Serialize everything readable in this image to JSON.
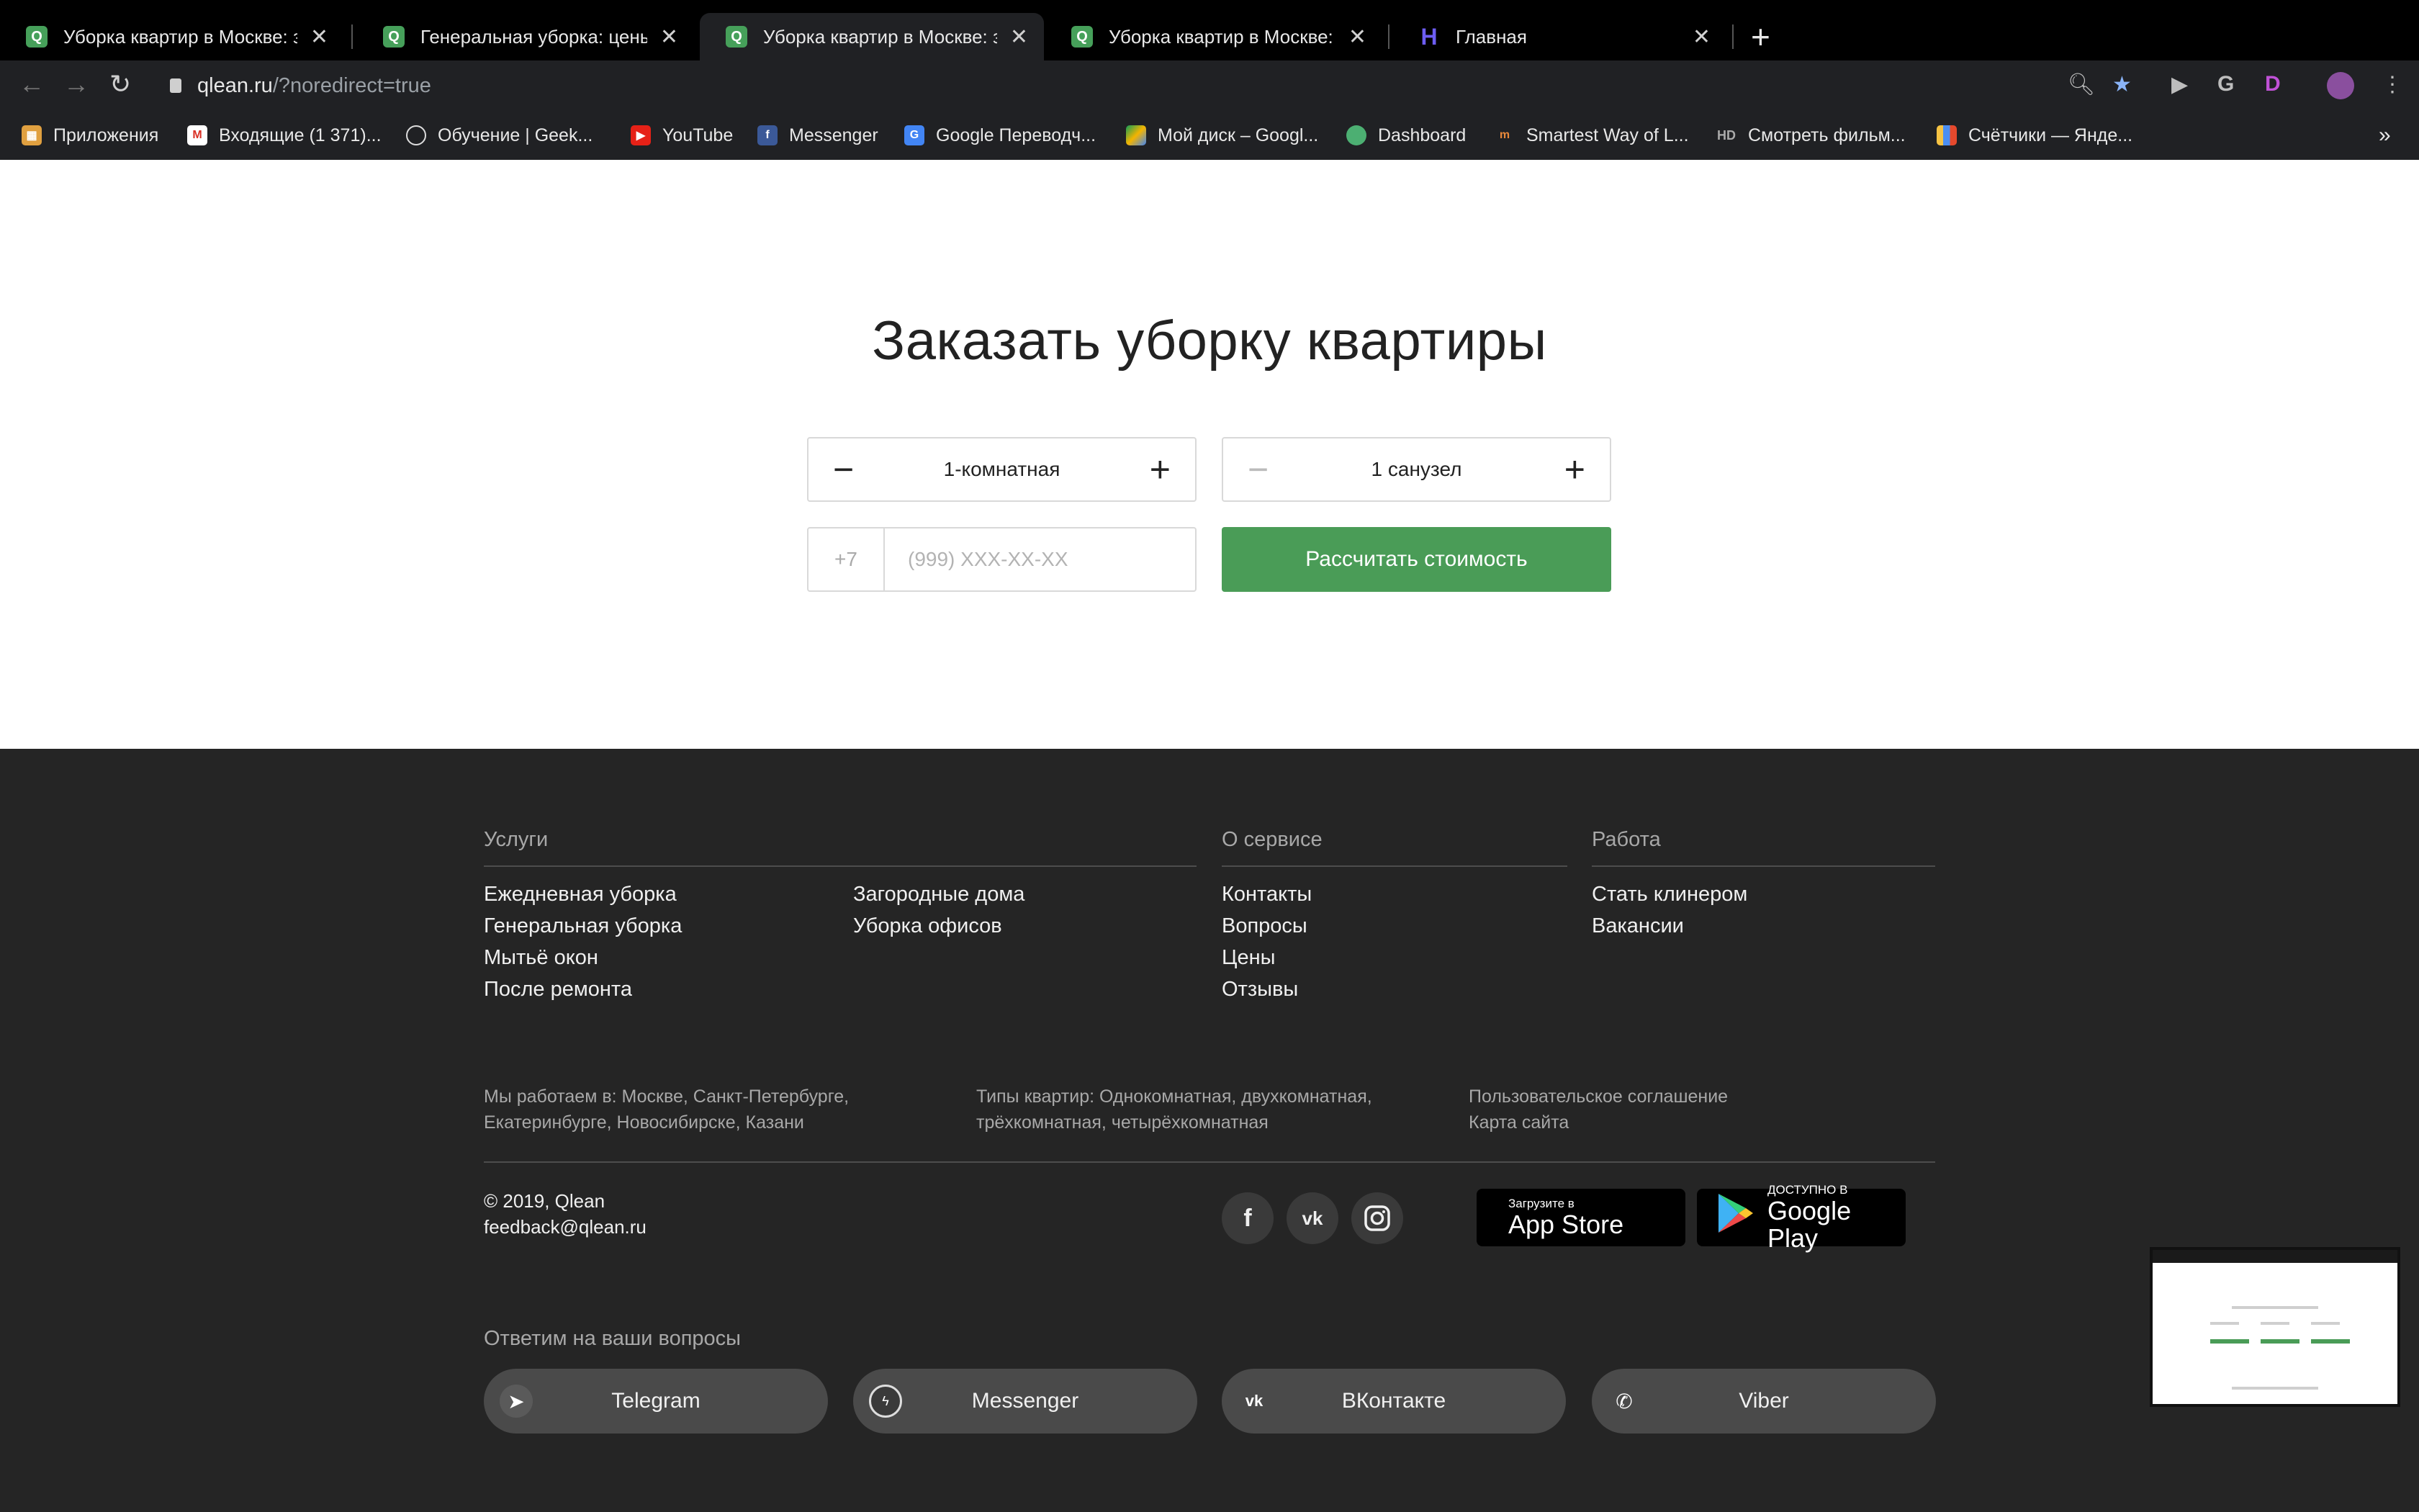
{
  "browser": {
    "tabs": [
      {
        "title": "Уборка квартир в Москве: за",
        "favicon": "Q"
      },
      {
        "title": "Генеральная уборка: цены на",
        "favicon": "Q"
      },
      {
        "title": "Уборка квартир в Москве: за",
        "favicon": "Q"
      },
      {
        "title": "Уборка квартир в Москве: за",
        "favicon": "Q"
      },
      {
        "title": "Главная",
        "favicon": "H"
      }
    ],
    "url_host": "qlean.ru",
    "url_path": "/?noredirect=true",
    "bookmarks": [
      "Приложения",
      "Входящие (1 371)...",
      "Обучение | Geek...",
      "YouTube",
      "Messenger",
      "Google Переводч...",
      "Мой диск – Googl...",
      "Dashboard",
      "Smartest Way of L...",
      "Смотреть фильм...",
      "Счётчики — Янде..."
    ],
    "bookmarks_overflow": "»"
  },
  "order": {
    "title": "Заказать уборку квартиры",
    "rooms_value": "1-комнатная",
    "bathrooms_value": "1 санузел",
    "phone_code": "+7",
    "phone_placeholder": "(999) XXX-XX-XX",
    "submit_label": "Рассчитать стоимость"
  },
  "footer": {
    "services": {
      "heading": "Услуги",
      "links": [
        "Ежедневная уборка",
        "Генеральная уборка",
        "Мытьё окон",
        "После ремонта",
        "Загородные дома",
        "Уборка офисов"
      ]
    },
    "about": {
      "heading": "О сервисе",
      "links": [
        "Контакты",
        "Вопросы",
        "Цены",
        "Отзывы"
      ]
    },
    "work": {
      "heading": "Работа",
      "links": [
        "Стать клинером",
        "Вакансии"
      ]
    },
    "cities_line1": "Мы работаем в: Москве, Санкт-Петербурге,",
    "cities_line2": "Екатеринбурге, Новосибирске, Казани",
    "types_line1": "Типы квартир: Однокомнатная, двухкомнатная,",
    "types_line2": "трёхкомнатная, четырёхкомнатная",
    "agreement": "Пользовательское соглашение",
    "sitemap": "Карта сайта",
    "copyright": "© 2019, Qlean",
    "email": "feedback@qlean.ru",
    "appstore_small": "Загрузите в",
    "appstore_big": "App Store",
    "googleplay_small": "ДОСТУПНО В",
    "googleplay_big": "Google Play",
    "questions_heading": "Ответим на ваши вопросы",
    "messengers": [
      "Telegram",
      "Messenger",
      "ВКонтакте",
      "Viber"
    ]
  },
  "colors": {
    "accent_green": "#4a9c57",
    "footer_bg": "#252525",
    "chrome_bg": "#202124"
  }
}
